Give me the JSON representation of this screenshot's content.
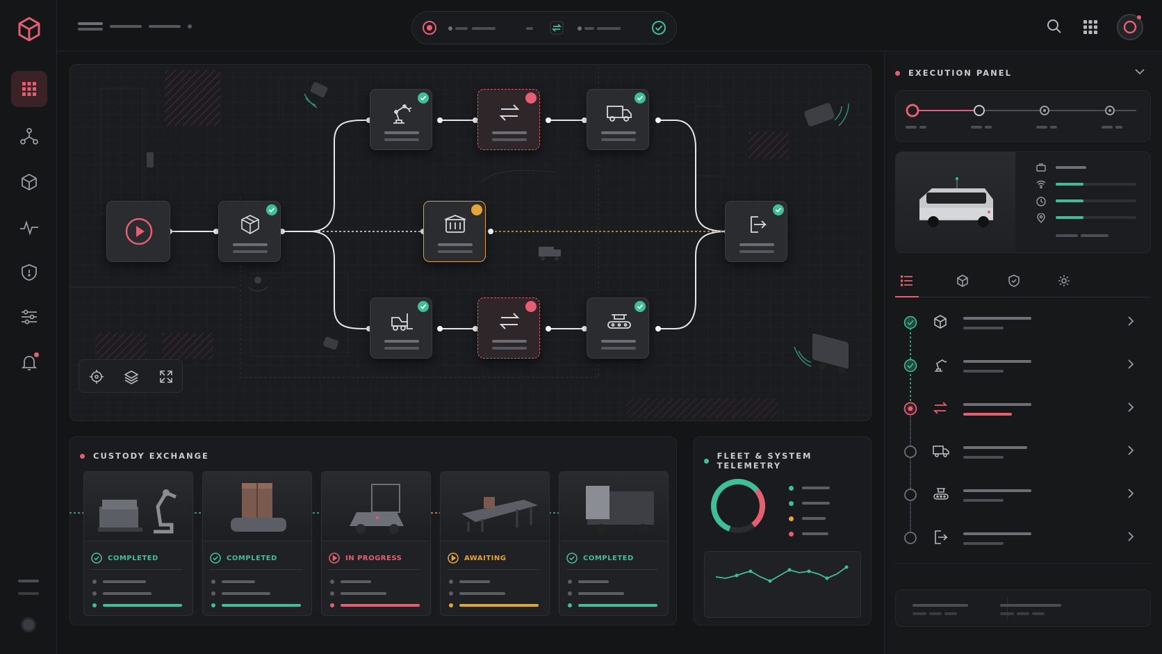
{
  "execution_panel": {
    "title": "EXECUTION PANEL"
  },
  "custody_exchange": {
    "title": "CUSTODY EXCHANGE",
    "cards": [
      {
        "status": "COMPLETED",
        "color": "#3fbf95"
      },
      {
        "status": "COMPLETED",
        "color": "#3fbf95"
      },
      {
        "status": "IN PROGRESS",
        "color": "#e65e72"
      },
      {
        "status": "AWAITING",
        "color": "#e3a53a"
      },
      {
        "status": "COMPLETED",
        "color": "#3fbf95"
      }
    ]
  },
  "fleet_telemetry": {
    "title": "FLEET & SYSTEM TELEMETRY"
  },
  "colors": {
    "accent": "#e65e72",
    "success": "#3fbf95",
    "warning": "#e3a53a",
    "background": "#141517"
  },
  "icons": {
    "sidebar": [
      "dashboard-grid-icon",
      "network-icon",
      "cube-icon",
      "activity-icon",
      "shield-icon",
      "sliders-icon",
      "bell-icon"
    ],
    "workflow": [
      "play-icon",
      "package-icon",
      "robot-arm-icon",
      "transfer-icon",
      "truck-icon",
      "container-icon",
      "forklift-icon",
      "conveyor-icon",
      "exit-icon"
    ],
    "tabs": [
      "list-icon",
      "cube-icon",
      "shield-icon",
      "gear-icon"
    ]
  }
}
